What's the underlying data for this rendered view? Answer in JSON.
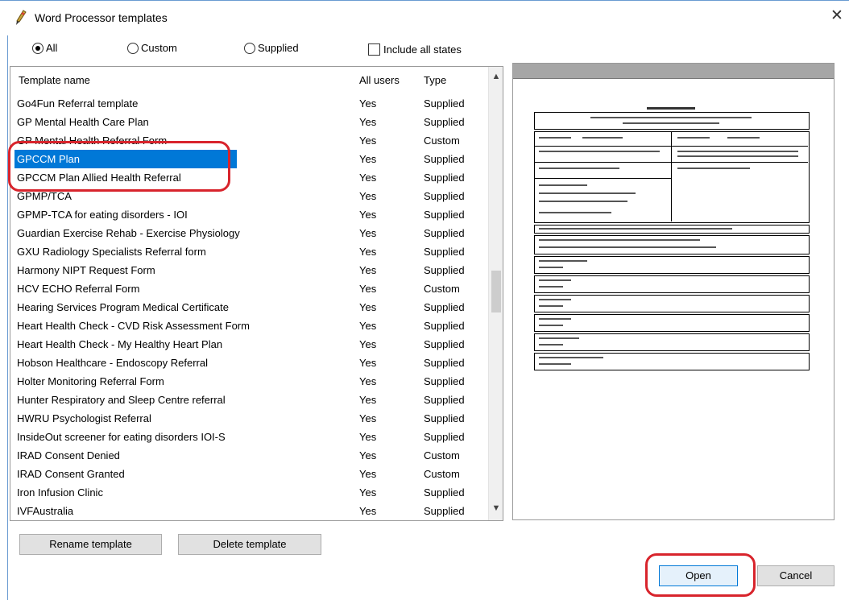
{
  "window": {
    "title": "Word Processor templates",
    "close_glyph": "✕"
  },
  "filters": {
    "all_label": "All",
    "custom_label": "Custom",
    "supplied_label": "Supplied",
    "selected": "All",
    "include_all_states_label": "Include all states",
    "include_all_states_checked": false
  },
  "table": {
    "columns": [
      "Template name",
      "All users",
      "Type"
    ],
    "rows": [
      {
        "name": "Go4Fun Referral template",
        "all_users": "Yes",
        "type": "Supplied"
      },
      {
        "name": "GP Mental Health Care Plan",
        "all_users": "Yes",
        "type": "Supplied"
      },
      {
        "name": "GP Mental Health Referral Form",
        "all_users": "Yes",
        "type": "Custom"
      },
      {
        "name": "GPCCM Plan",
        "all_users": "Yes",
        "type": "Supplied",
        "selected": true
      },
      {
        "name": "GPCCM Plan Allied Health Referral",
        "all_users": "Yes",
        "type": "Supplied"
      },
      {
        "name": "GPMP/TCA",
        "all_users": "Yes",
        "type": "Supplied"
      },
      {
        "name": "GPMP-TCA for eating disorders - IOI",
        "all_users": "Yes",
        "type": "Supplied"
      },
      {
        "name": "Guardian Exercise Rehab - Exercise Physiology",
        "all_users": "Yes",
        "type": "Supplied"
      },
      {
        "name": "GXU Radiology Specialists Referral form",
        "all_users": "Yes",
        "type": "Supplied"
      },
      {
        "name": "Harmony NIPT Request Form",
        "all_users": "Yes",
        "type": "Supplied"
      },
      {
        "name": "HCV ECHO Referral Form",
        "all_users": "Yes",
        "type": "Custom"
      },
      {
        "name": "Hearing Services Program Medical Certificate",
        "all_users": "Yes",
        "type": "Supplied"
      },
      {
        "name": "Heart Health Check - CVD Risk Assessment Form",
        "all_users": "Yes",
        "type": "Supplied"
      },
      {
        "name": "Heart Health Check - My Healthy Heart Plan",
        "all_users": "Yes",
        "type": "Supplied"
      },
      {
        "name": "Hobson Healthcare - Endoscopy Referral",
        "all_users": "Yes",
        "type": "Supplied"
      },
      {
        "name": "Holter Monitoring Referral Form",
        "all_users": "Yes",
        "type": "Supplied"
      },
      {
        "name": "Hunter Respiratory and Sleep Centre referral",
        "all_users": "Yes",
        "type": "Supplied"
      },
      {
        "name": "HWRU Psychologist Referral",
        "all_users": "Yes",
        "type": "Supplied"
      },
      {
        "name": "InsideOut screener for eating disorders  IOI-S",
        "all_users": "Yes",
        "type": "Supplied"
      },
      {
        "name": "IRAD Consent Denied",
        "all_users": "Yes",
        "type": "Custom"
      },
      {
        "name": "IRAD Consent Granted",
        "all_users": "Yes",
        "type": "Custom"
      },
      {
        "name": "Iron Infusion Clinic",
        "all_users": "Yes",
        "type": "Supplied"
      },
      {
        "name": "IVFAustralia",
        "all_users": "Yes",
        "type": "Supplied"
      }
    ]
  },
  "buttons": {
    "rename": "Rename template",
    "delete": "Delete template",
    "open": "Open",
    "cancel": "Cancel"
  },
  "colors": {
    "selection": "#0078d7",
    "highlight_annotation": "#d8242c"
  }
}
